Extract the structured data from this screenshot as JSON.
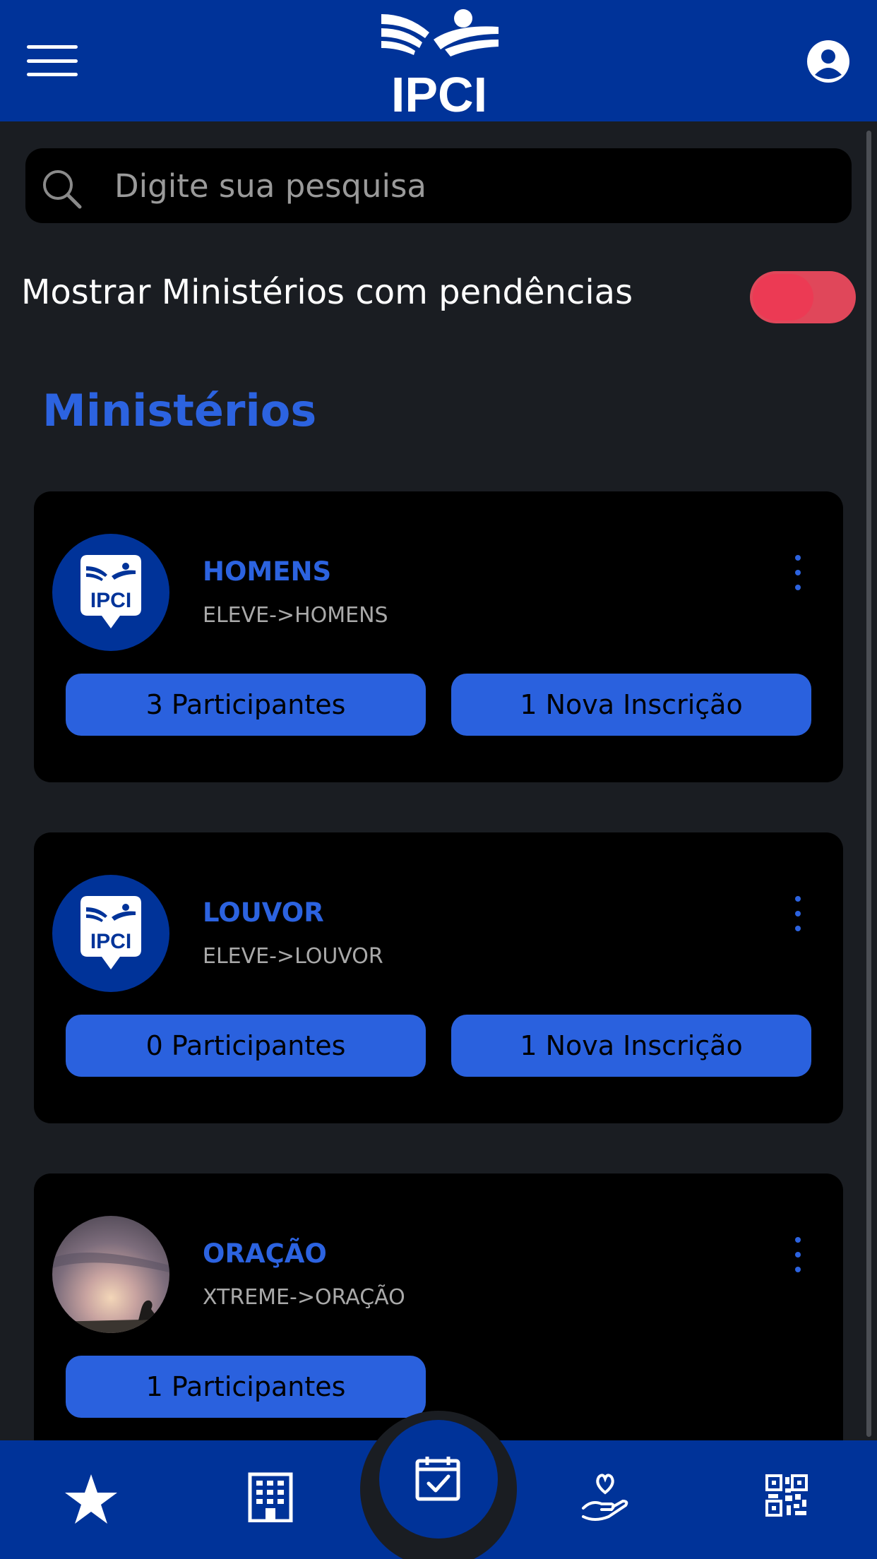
{
  "header": {
    "logo_text": "IPCI",
    "menu_icon": "hamburger-menu-icon",
    "profile_icon": "account-circle-icon"
  },
  "search": {
    "placeholder": "Digite sua pesquisa",
    "icon": "search-icon"
  },
  "filter": {
    "label": "Mostrar Ministérios com pendências",
    "toggle_color": "#e0475a"
  },
  "section_title": "Ministérios",
  "ministries": [
    {
      "title": "HOMENS",
      "subtitle": "ELEVE->HOMENS",
      "participants_label": "3 Participantes",
      "new_signups_label": "1 Nova Inscrição"
    },
    {
      "title": "LOUVOR",
      "subtitle": "ELEVE->LOUVOR",
      "participants_label": "0 Participantes",
      "new_signups_label": "1 Nova Inscrição"
    },
    {
      "title": "ORAÇÃO",
      "subtitle": "XTREME->ORAÇÃO",
      "participants_label": "1 Participantes"
    }
  ],
  "bottom_nav": {
    "items": [
      "star-icon",
      "building-icon",
      "calendar-check-icon",
      "heart-hand-icon",
      "qr-code-icon"
    ]
  },
  "colors": {
    "brand_blue": "#003399",
    "accent_blue": "#2a61de",
    "background": "#1a1d22",
    "card": "#000000"
  }
}
